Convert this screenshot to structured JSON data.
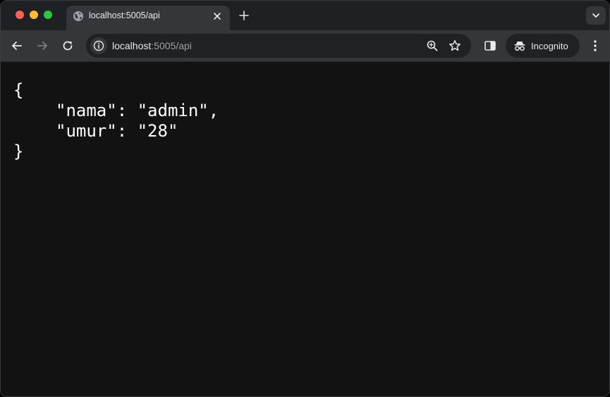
{
  "tab": {
    "title": "localhost:5005/api"
  },
  "omnibox": {
    "host": "localhost",
    "path": ":5005/api"
  },
  "incognito": {
    "label": "Incognito"
  },
  "colors": {
    "background": "#121212",
    "toolbar": "#35363a",
    "tabstrip": "#1f2023",
    "text": "#ffffff"
  },
  "json_view": {
    "open": "{",
    "line1": "\"nama\": \"admin\",",
    "line2": "\"umur\": \"28\"",
    "close": "}"
  },
  "icons": {
    "tab": "globe-icon",
    "tab_close": "close-icon",
    "new_tab": "plus-icon",
    "back": "arrow-left-icon",
    "forward": "arrow-right-icon",
    "reload": "reload-icon",
    "site_info": "info-icon",
    "zoom": "zoom-icon",
    "bookmark": "star-icon",
    "side_panel": "side-panel-icon",
    "incognito": "incognito-icon",
    "menu": "kebab-menu-icon",
    "tab_search": "chevron-down-icon"
  }
}
